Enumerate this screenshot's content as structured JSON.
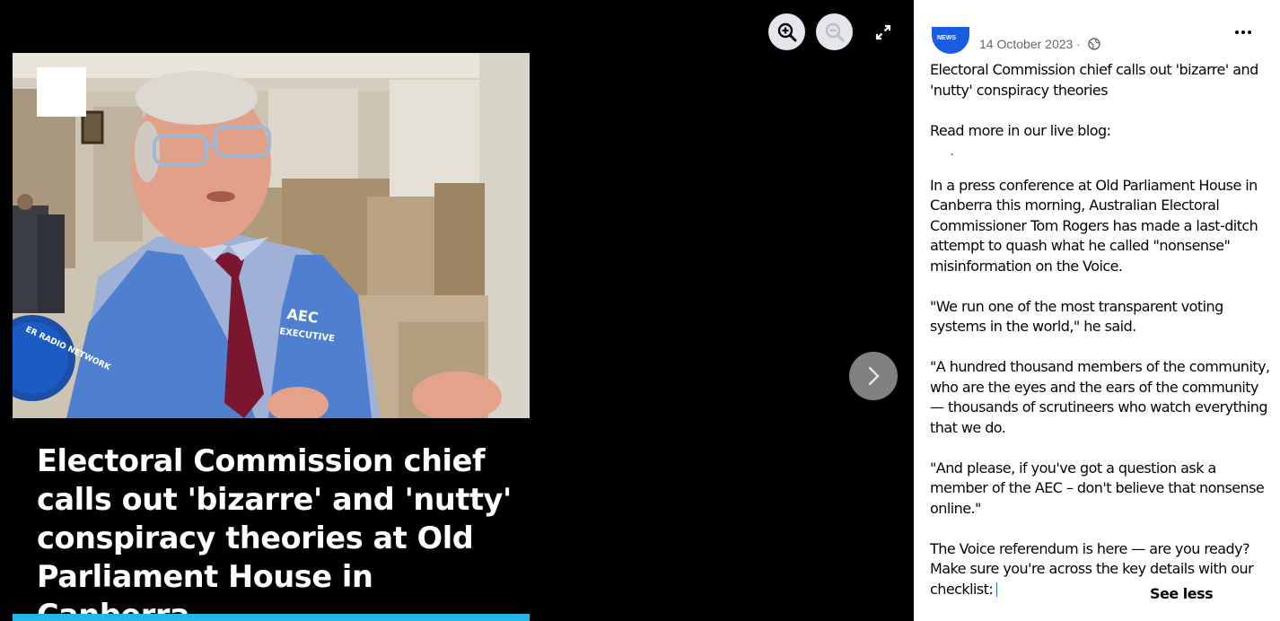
{
  "viewer": {
    "zoom_in_label": "Zoom in",
    "zoom_out_label": "Zoom out",
    "fullscreen_label": "Enter full screen",
    "next_label": "Next photo",
    "image": {
      "vest_line1": "AEC",
      "vest_line2": "EXECUTIVE",
      "mic_text": "ER RADIO NETWORK",
      "caption": "Electoral Commission chief calls out 'bizarre' and 'nutty' conspiracy theories at Old Parliament House in Canberra"
    }
  },
  "post": {
    "avatar_text": "NEWS",
    "date": "14 October 2023 ·",
    "more_label": "•••",
    "paragraphs": [
      "Electoral Commission chief calls out 'bizarre' and 'nutty' conspiracy theories",
      "Read more in our live blog:",
      "In a press conference at Old Parliament House in Canberra this morning, Australian Electoral Commissioner Tom Rogers has made a last-ditch attempt to quash what he called \"nonsense\" misinformation on the Voice.",
      "\"We run one of the most transparent voting systems in the world,\" he said.",
      "\"A hundred thousand members of the community, who are the eyes and the ears of the community — thousands of scrutineers who watch everything that we do.",
      "\"And please, if you've got a question ask a member of the AEC – don't believe that nonsense online.\"",
      "The Voice referendum is here — are you ready? Make sure you're across the key details with our checklist:"
    ],
    "link_dot": ".",
    "see_less": "See less"
  },
  "colors": {
    "accent": "#22b7e8",
    "link": "#216fdb",
    "brand": "#1a5de2"
  }
}
